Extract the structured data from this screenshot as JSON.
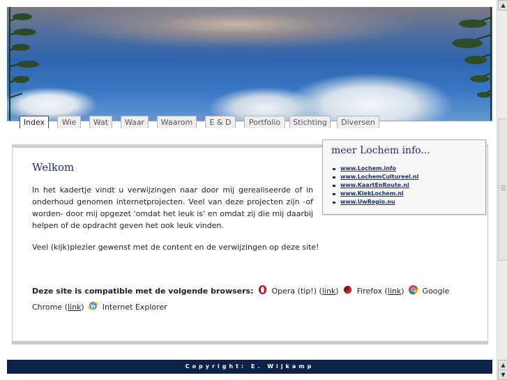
{
  "nav": {
    "tabs": [
      {
        "label": "Index",
        "active": true
      },
      {
        "label": "Wie"
      },
      {
        "label": "Wat"
      },
      {
        "label": "Waar"
      },
      {
        "label": "Waarom"
      },
      {
        "label": "E & D"
      },
      {
        "label": "Portfolio"
      },
      {
        "label": "Stichting"
      },
      {
        "label": "Diversen"
      }
    ]
  },
  "main": {
    "title": "Welkom",
    "intro": "In het kadertje vindt u verwijzingen naar door mij gerealiseerde of in onderhoud genomen internetprojecten. Veel van deze projecten zijn -of worden- door mij opgezet 'omdat het leuk is' en omdat zij die mij daarbij helpen of de opdracht geven het ook leuk vinden.",
    "greeting": "Veel (kijk)plezier gewenst met de content en de verwijzingen op deze site!",
    "compat": {
      "heading": "Deze site is compatible met de volgende browsers:",
      "opera": "Opera (tip!)",
      "firefox": "Firefox",
      "chrome": "Google Chrome",
      "ie": "Internet Explorer",
      "link_label": "link"
    }
  },
  "sidebox": {
    "title": "meer Lochem info...",
    "links": [
      "www.Lochem.info",
      "www.LochemCultureel.nl",
      "www.KaartEnRoute.nl",
      "www.KiekLochem.nl",
      "www.UwRegio.nu"
    ]
  },
  "footer": {
    "copyright": "Copyright: E. Wijkamp"
  },
  "icons": {
    "opera": "opera-icon",
    "firefox": "firefox-icon",
    "chrome": "chrome-icon",
    "ie": "internet-explorer-icon"
  },
  "colors": {
    "title": "#1a2f78",
    "footer_bg": "#0c2248"
  }
}
